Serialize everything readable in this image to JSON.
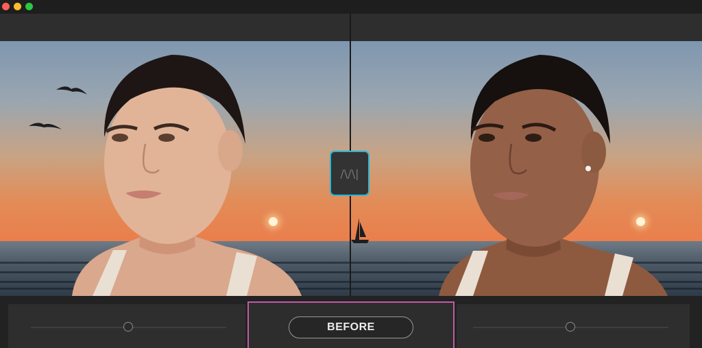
{
  "window": {
    "controls": [
      {
        "name": "close",
        "color": "#ff5f57"
      },
      {
        "name": "minimize",
        "color": "#febc2e"
      },
      {
        "name": "zoom",
        "color": "#28c840"
      }
    ]
  },
  "comparison": {
    "left_image": {
      "description_icon": "portrait-photo"
    },
    "right_image": {
      "description_icon": "portrait-photo"
    },
    "split_handle": {
      "glyph": "/\\/\\|",
      "accent_color": "#29b6d8"
    }
  },
  "controls": {
    "left_slider_value": 0.5,
    "right_slider_value": 0.5,
    "toggle_label": "BEFORE",
    "highlight_color": "#c45aa8"
  }
}
